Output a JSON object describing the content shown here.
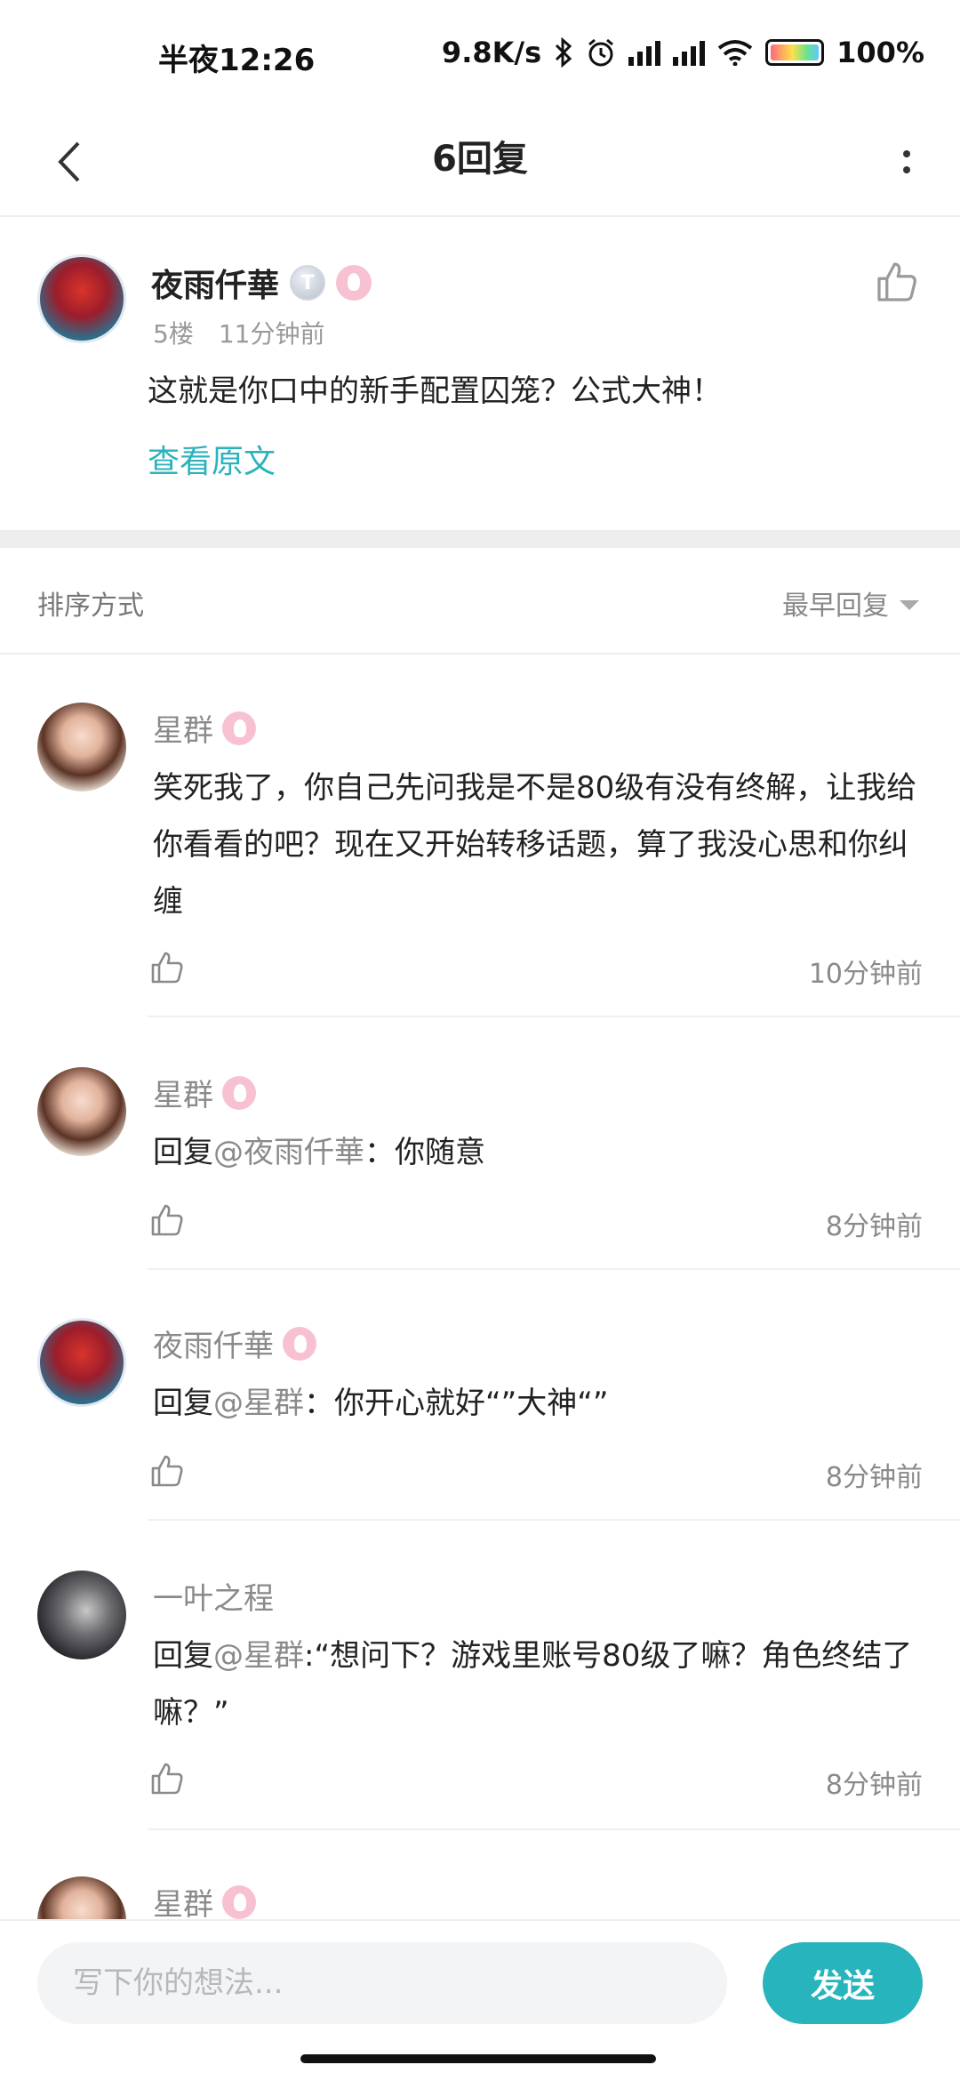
{
  "status_bar": {
    "time": "半夜12:26",
    "network_speed": "9.8K/s",
    "battery": "100%",
    "battery_level": 100
  },
  "header": {
    "title": "6回复"
  },
  "post": {
    "username": "夜雨仟華",
    "badge_letter": "T",
    "floor": "5楼",
    "time": "11分钟前",
    "content": "这就是你口中的新手配置囚笼？公式大神！",
    "view_original": "查看原文"
  },
  "sort": {
    "label": "排序方式",
    "selected": "最早回复"
  },
  "replies": [
    {
      "username": "星群",
      "reply_prefix": "",
      "mention": "",
      "content": "笑死我了，你自己先问我是不是80级有没有终解，让我给你看看的吧？现在又开始转移话题，算了我没心思和你纠缠",
      "time": "10分钟前"
    },
    {
      "username": "星群",
      "reply_prefix": "回复",
      "mention": "@夜雨仟華",
      "content": "：你随意",
      "time": "8分钟前"
    },
    {
      "username": "夜雨仟華",
      "reply_prefix": "回复",
      "mention": "@星群",
      "content": "：你开心就好“”大神“”",
      "time": "8分钟前"
    },
    {
      "username": "一叶之程",
      "reply_prefix": "回复",
      "mention": "@星群",
      "content": ":“想问下？游戏里账号80级了嘛？角色终结了嘛？”",
      "time": "8分钟前"
    },
    {
      "username": "星群"
    }
  ],
  "composer": {
    "placeholder": "写下你的想法...",
    "send_label": "发送"
  },
  "colors": {
    "accent": "#28b4bd",
    "link": "#2bb3bd",
    "secondary_text": "#8a8a8a"
  }
}
